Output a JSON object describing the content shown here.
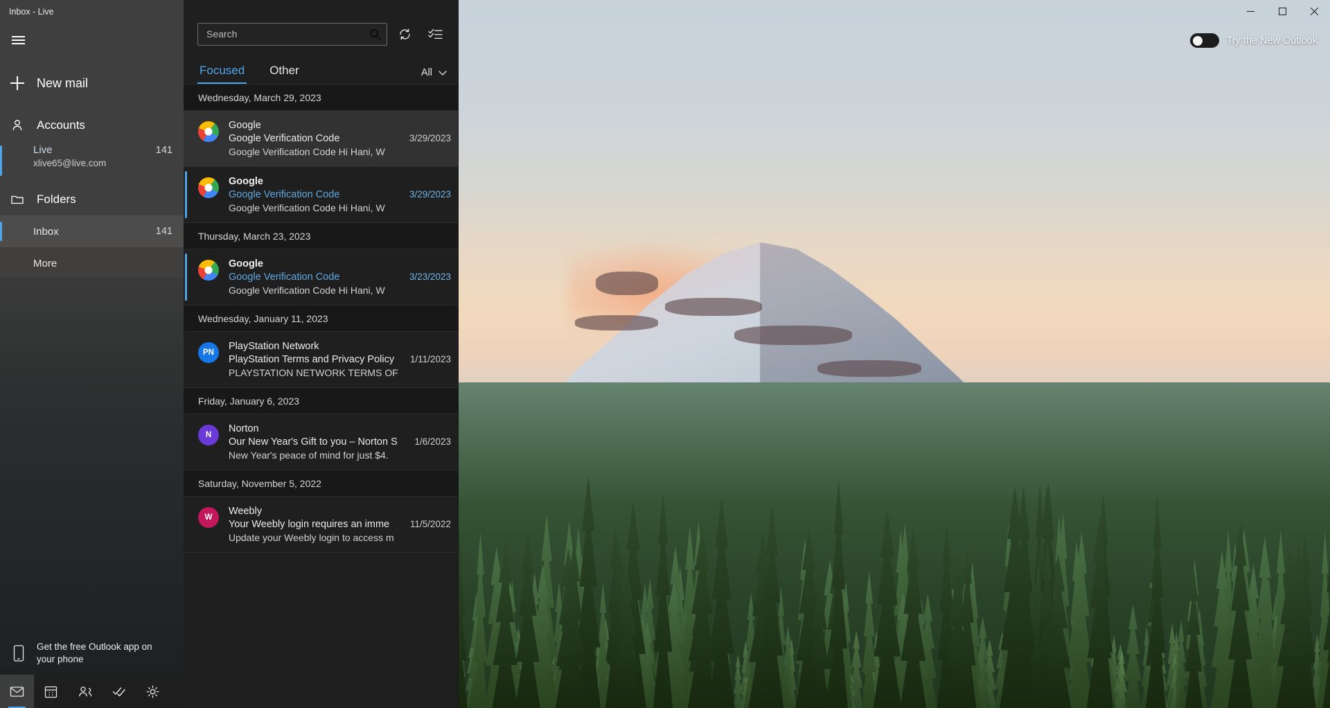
{
  "window": {
    "title": "Inbox - Live",
    "minimize_icon": "minimize-icon",
    "maximize_icon": "maximize-icon",
    "close_icon": "close-icon"
  },
  "new_outlook": {
    "label": "Try the New Outlook",
    "state": "off"
  },
  "sidebar": {
    "menu_icon": "hamburger-icon",
    "new_mail": {
      "label": "New mail",
      "icon": "plus-icon"
    },
    "accounts": {
      "label": "Accounts",
      "icon": "person-icon"
    },
    "account": {
      "name": "Live",
      "email": "xlive65@live.com",
      "count": "141",
      "selected": true
    },
    "folders": {
      "label": "Folders",
      "icon": "folder-icon"
    },
    "folder_items": [
      {
        "name": "Inbox",
        "count": "141",
        "selected": true
      },
      {
        "name": "More",
        "count": "",
        "selected": false
      }
    ],
    "promo": {
      "line1": "Get the free Outlook app on",
      "line2": "your phone",
      "icon": "phone-icon"
    },
    "nav": [
      {
        "name": "mail",
        "icon": "mail-icon",
        "active": true
      },
      {
        "name": "calendar",
        "icon": "calendar-icon",
        "active": false
      },
      {
        "name": "people",
        "icon": "people-icon",
        "active": false
      },
      {
        "name": "tasks",
        "icon": "tasks-icon",
        "active": false
      },
      {
        "name": "settings",
        "icon": "gear-icon",
        "active": false
      }
    ]
  },
  "maillist": {
    "search": {
      "placeholder": "Search",
      "value": "",
      "icon": "search-icon"
    },
    "refresh_icon": "refresh-icon",
    "select_icon": "select-mode-icon",
    "tabs": [
      {
        "label": "Focused",
        "active": true
      },
      {
        "label": "Other",
        "active": false
      }
    ],
    "filter": {
      "label": "All",
      "icon": "chevron-down-icon"
    },
    "groups": [
      {
        "date": "Wednesday, March 29, 2023",
        "items": [
          {
            "sender": "Google",
            "subject": "Google Verification Code",
            "preview": "Google Verification Code Hi Hani, W",
            "date": "3/29/2023",
            "avatar_type": "google",
            "avatar_initials": "",
            "avatar_color": "",
            "unread": false,
            "hover": true
          },
          {
            "sender": "Google",
            "subject": "Google Verification Code",
            "preview": "Google Verification Code Hi Hani, W",
            "date": "3/29/2023",
            "avatar_type": "google",
            "avatar_initials": "",
            "avatar_color": "",
            "unread": true,
            "hover": false
          }
        ]
      },
      {
        "date": "Thursday, March 23, 2023",
        "items": [
          {
            "sender": "Google",
            "subject": "Google Verification Code",
            "preview": "Google Verification Code Hi Hani, W",
            "date": "3/23/2023",
            "avatar_type": "google",
            "avatar_initials": "",
            "avatar_color": "",
            "unread": true,
            "hover": false
          }
        ]
      },
      {
        "date": "Wednesday, January 11, 2023",
        "items": [
          {
            "sender": "PlayStation Network",
            "subject": "PlayStation Terms and Privacy Policy",
            "preview": "PLAYSTATION NETWORK TERMS OF",
            "date": "1/11/2023",
            "avatar_type": "initials",
            "avatar_initials": "PN",
            "avatar_color": "#1877e6",
            "unread": false,
            "hover": false
          }
        ]
      },
      {
        "date": "Friday, January 6, 2023",
        "items": [
          {
            "sender": "Norton",
            "subject": "Our New Year's Gift to you – Norton S",
            "preview": "New Year's peace of mind for just $4.",
            "date": "1/6/2023",
            "avatar_type": "initials",
            "avatar_initials": "N",
            "avatar_color": "#6a39d6",
            "unread": false,
            "hover": false
          }
        ]
      },
      {
        "date": "Saturday, November 5, 2022",
        "items": [
          {
            "sender": "Weebly",
            "subject": "Your Weebly login requires an imme",
            "preview": "Update your Weebly login to access m",
            "date": "11/5/2022",
            "avatar_type": "initials",
            "avatar_initials": "W",
            "avatar_color": "#c2185b",
            "unread": false,
            "hover": false
          }
        ]
      }
    ]
  },
  "colors": {
    "accent": "#4ea6ea",
    "sidebar_bg": "#3a3a3a",
    "list_bg": "#1f1f1f"
  }
}
